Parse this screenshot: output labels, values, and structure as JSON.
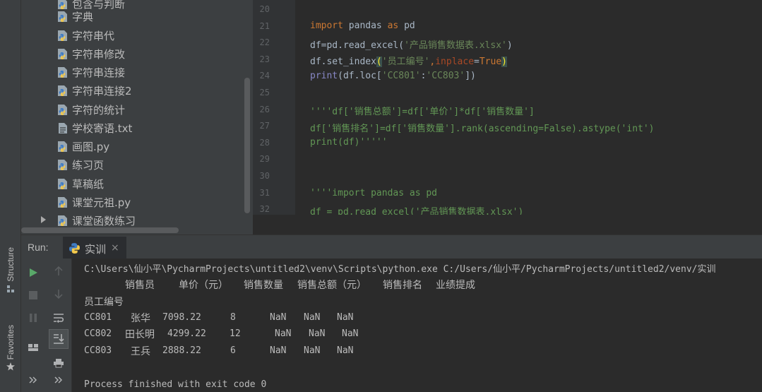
{
  "side_tabs": {
    "structure": "Structure",
    "favorites": "Favorites"
  },
  "project_tree": {
    "items": [
      {
        "label": "包含与判断",
        "icon": "python-file-icon"
      },
      {
        "label": "字典",
        "icon": "python-file-icon"
      },
      {
        "label": "字符串代",
        "icon": "python-file-icon"
      },
      {
        "label": "字符串修改",
        "icon": "python-file-icon"
      },
      {
        "label": "字符串连接",
        "icon": "python-file-icon"
      },
      {
        "label": "字符串连接2",
        "icon": "python-file-icon"
      },
      {
        "label": "字符的统计",
        "icon": "python-file-icon"
      },
      {
        "label": "学校寄语.txt",
        "icon": "text-file-icon"
      },
      {
        "label": "画图.py",
        "icon": "python-file-icon"
      },
      {
        "label": "练习页",
        "icon": "python-file-icon"
      },
      {
        "label": "草稿纸",
        "icon": "python-file-icon"
      },
      {
        "label": "课堂元祖.py",
        "icon": "python-file-icon"
      },
      {
        "label": "课堂函数练习",
        "icon": "python-file-icon"
      }
    ]
  },
  "editor": {
    "line_numbers": [
      "20",
      "21",
      "22",
      "23",
      "24",
      "25",
      "26",
      "27",
      "28",
      "29",
      "30",
      "31",
      "32"
    ],
    "lines": {
      "l21_a": "import",
      "l21_b": " pandas ",
      "l21_c": "as",
      "l21_d": " pd",
      "l22_a": "df=pd.read_excel(",
      "l22_b": "'产品销售数据表.xlsx'",
      "l22_c": ")",
      "l23_a": "df.set_index",
      "l23_b": "(",
      "l23_c": "'员工编号'",
      "l23_d": ",",
      "l23_e": "inplace",
      "l23_f": "=",
      "l23_g": "True",
      "l23_h": ")",
      "l24_a": "print",
      "l24_b": "(df.loc[",
      "l24_c": "'CC801'",
      "l24_d": ":",
      "l24_e": "'CC803'",
      "l24_f": "])",
      "l26": "''''df['销售总额']=df['单价']*df['销售数量']",
      "l27": "df['销售排名']=df['销售数量'].rank(ascending=False).astype('int')",
      "l28": "print(df)'''''",
      "l31": "''''import pandas as pd",
      "l32": "df = pd.read_excel('产品销售数据表.xlsx')"
    }
  },
  "run": {
    "title": "Run:",
    "tab_label": "实训",
    "tab_close": "×",
    "console": {
      "command": "C:\\Users\\仙小平\\PycharmProjects\\untitled2\\venv\\Scripts\\python.exe C:/Users/仙小平/PycharmProjects/untitled2/venv/实训",
      "headers": [
        "销售员",
        "单价（元）",
        "销售数量",
        "销售总额（元）",
        "销售排名",
        "业绩提成"
      ],
      "index_name": "员工编号",
      "rows": [
        {
          "id": "CC801",
          "name": "张华",
          "price": "7098.22",
          "qty": "8",
          "total": "NaN",
          "rank": "NaN",
          "bonus": "NaN"
        },
        {
          "id": "CC802",
          "name": "田长明",
          "price": "4299.22",
          "qty": "12",
          "total": "NaN",
          "rank": "NaN",
          "bonus": "NaN"
        },
        {
          "id": "CC803",
          "name": "王兵",
          "price": "2888.22",
          "qty": "6",
          "total": "NaN",
          "rank": "NaN",
          "bonus": "NaN"
        }
      ],
      "exit_message": "Process finished with exit code 0"
    }
  },
  "colors": {
    "keyword": "#cc7832",
    "string": "#6a8759",
    "docstring": "#629755",
    "run_green": "#59a869",
    "bg": "#2b2b2b",
    "panel": "#3c3f41"
  }
}
